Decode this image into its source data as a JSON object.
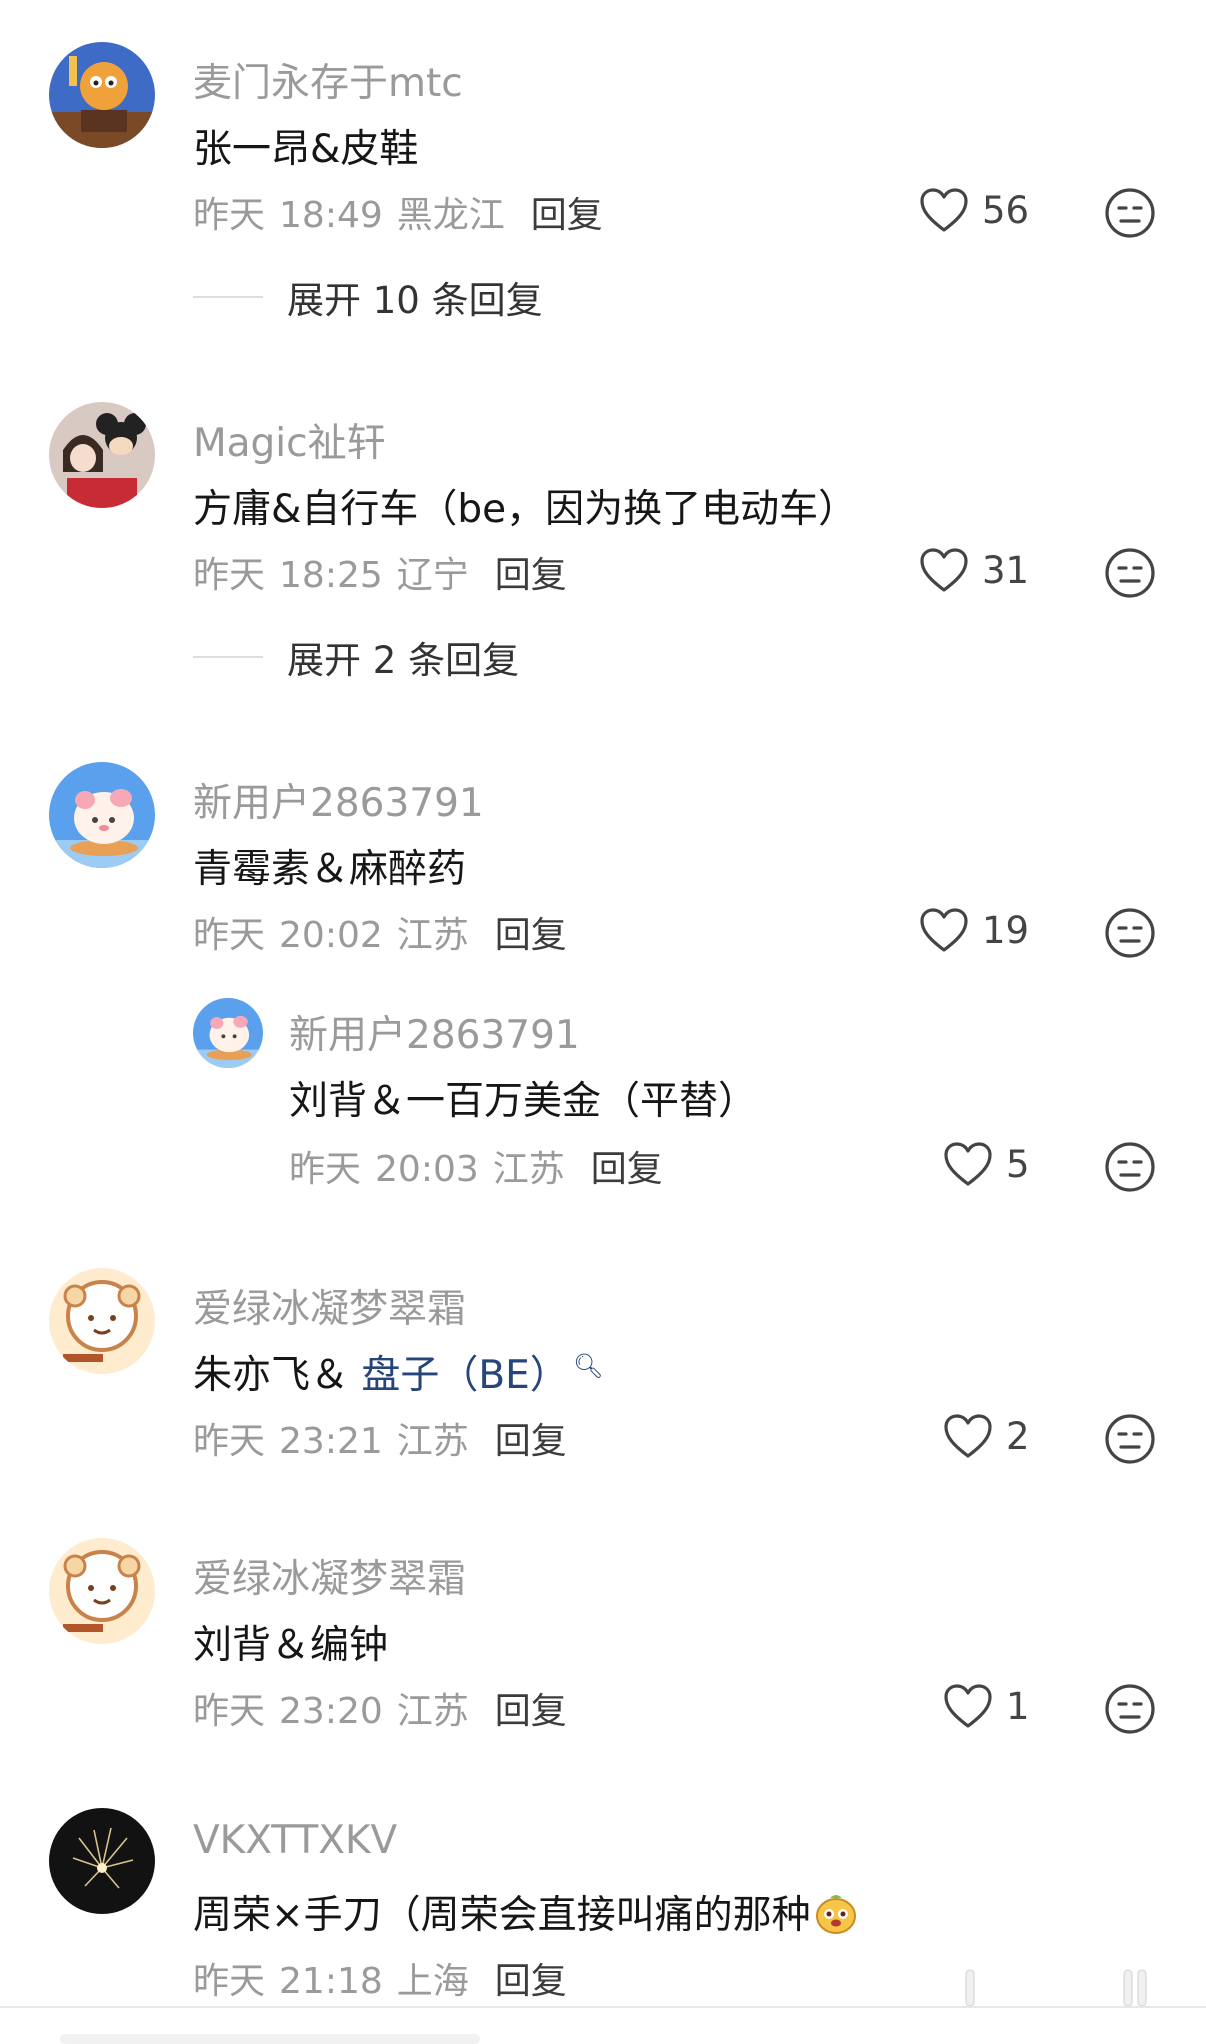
{
  "comments": [
    {
      "username": "麦门永存于mtc",
      "text": "张一昂&皮鞋",
      "date": "昨天",
      "time": "18:49",
      "region": "黑龙江",
      "reply_label": "回复",
      "likes": "56",
      "expand_label": "展开 10 条回复"
    },
    {
      "username": "Magic祉轩",
      "text": "方庸&自行车（be，因为换了电动车）",
      "date": "昨天",
      "time": "18:25",
      "region": "辽宁",
      "reply_label": "回复",
      "likes": "31",
      "expand_label": "展开 2 条回复"
    },
    {
      "username": "新用户2863791",
      "text": "青霉素＆麻醉药",
      "date": "昨天",
      "time": "20:02",
      "region": "江苏",
      "reply_label": "回复",
      "likes": "19"
    },
    {
      "username": "新用户2863791",
      "text": "刘背＆一百万美金（平替）",
      "date": "昨天",
      "time": "20:03",
      "region": "江苏",
      "reply_label": "回复",
      "likes": "5"
    },
    {
      "username": "爱绿冰凝梦翠霜",
      "text_prefix": "朱亦飞＆ ",
      "text_link": "盘子（BE）",
      "date": "昨天",
      "time": "23:21",
      "region": "江苏",
      "reply_label": "回复",
      "likes": "2"
    },
    {
      "username": "爱绿冰凝梦翠霜",
      "text": "刘背＆编钟",
      "date": "昨天",
      "time": "23:20",
      "region": "江苏",
      "reply_label": "回复",
      "likes": "1"
    },
    {
      "username": "VKXTTXKV",
      "text": "周荣×手刀（周荣会直接叫痛的那种",
      "date": "昨天",
      "time": "21:18",
      "region": "上海",
      "reply_label": "回复"
    }
  ],
  "icons": {
    "like": "heart-outline-icon",
    "reaction": "neutral-face-icon",
    "link_search": "search-icon",
    "emoji": "mascot-emoji-icon"
  },
  "colors": {
    "username": "#9a9a9a",
    "text": "#161616",
    "link": "#26457a",
    "background": "#ffffff"
  }
}
